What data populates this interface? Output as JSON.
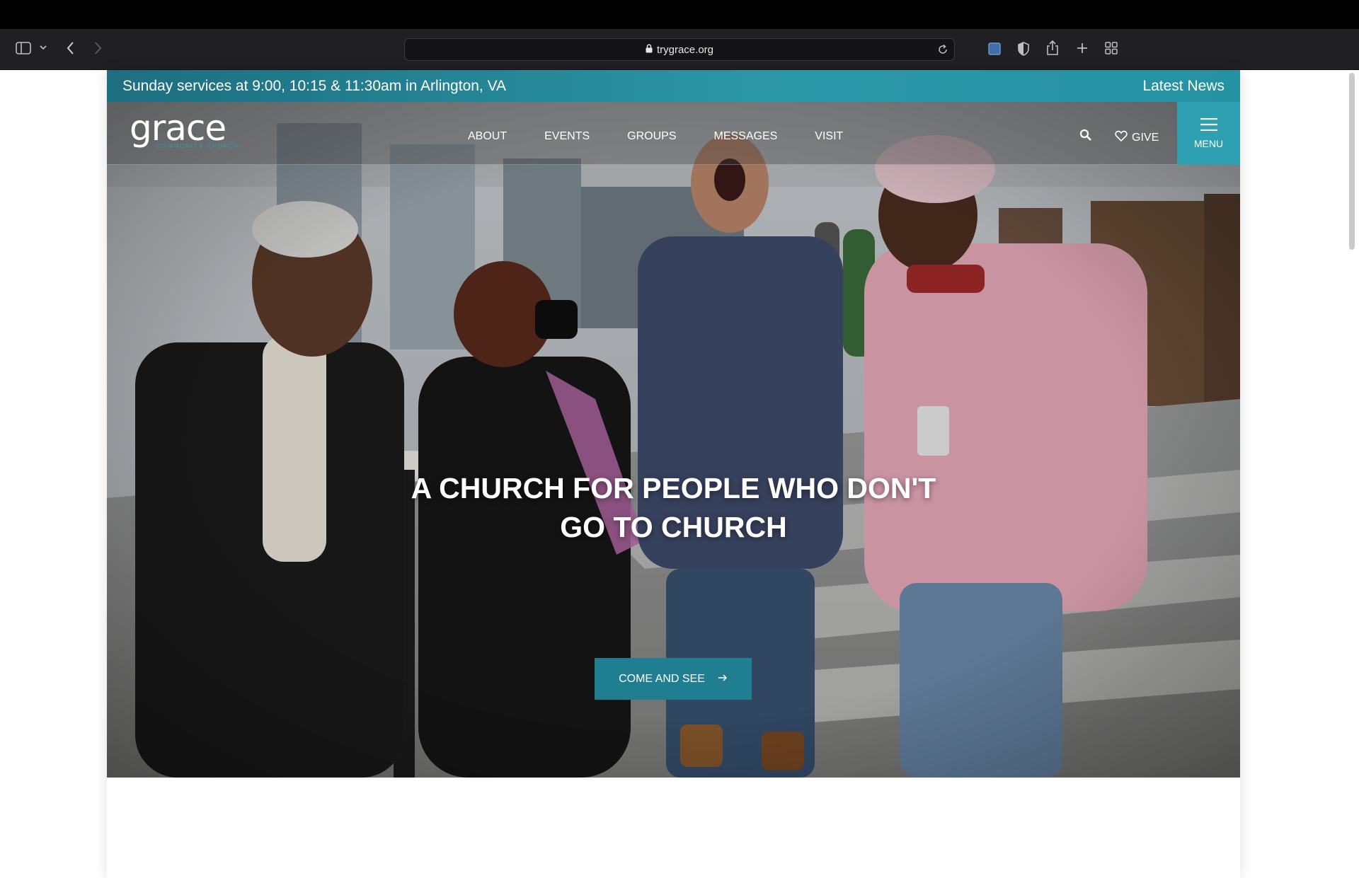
{
  "browser": {
    "url": "trygrace.org",
    "icons": [
      "sidebar-icon",
      "chevron-down-icon",
      "back-icon",
      "forward-icon",
      "lock-icon",
      "reload-icon",
      "extension-icon",
      "privacy-shield-icon",
      "share-icon",
      "new-tab-icon",
      "tab-overview-icon"
    ]
  },
  "announcement": {
    "text": "Sunday services at 9:00, 10:15 & 11:30am in Arlington, VA",
    "link": "Latest News"
  },
  "header": {
    "logo_word": "grace",
    "logo_sub": "COMMUNITY CHURCH",
    "nav": [
      "ABOUT",
      "EVENTS",
      "GROUPS",
      "MESSAGES",
      "VISIT"
    ],
    "give_label": "GIVE",
    "menu_label": "MENU"
  },
  "hero": {
    "headline_line1": "A CHURCH FOR PEOPLE WHO DON'T",
    "headline_line2": "GO TO CHURCH",
    "cta_label": "COME AND SEE",
    "cta_icon": "arrow-right-icon"
  },
  "colors": {
    "accent": "#2ea0b2",
    "cta": "#1f7f91",
    "announce_bar": "#2592a4",
    "toolbar": "#202022"
  }
}
